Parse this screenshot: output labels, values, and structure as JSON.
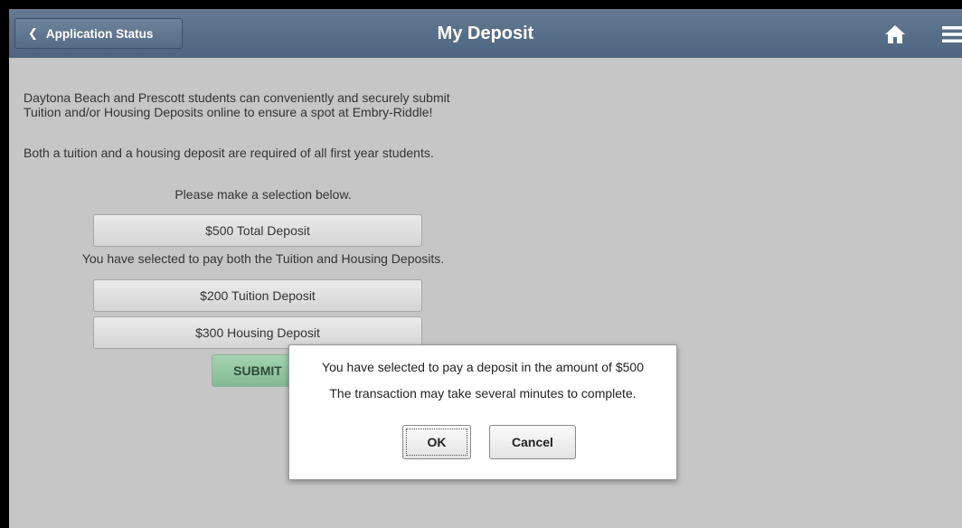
{
  "header": {
    "back_label": "Application Status",
    "title": "My Deposit",
    "home_icon": "home-icon",
    "menu_icon": "hamburger-menu-icon"
  },
  "content": {
    "intro_line1": "Daytona Beach and Prescott students can conveniently and securely submit",
    "intro_line2": "Tuition and/or Housing Deposits online to ensure a spot at Embry-Riddle!",
    "requirement": "Both a tuition and a housing deposit are required of all first year students.",
    "prompt": "Please make a selection below.",
    "total_deposit_label": "$500 Total Deposit",
    "selection_text": "You have selected to pay both the Tuition and Housing Deposits.",
    "tuition_deposit_label": "$200 Tuition Deposit",
    "housing_deposit_label": "$300 Housing Deposit",
    "submit_label": "SUBMIT"
  },
  "dialog": {
    "message1": "You have selected to pay a deposit in the amount of $500",
    "message2": "The transaction may take several minutes to complete.",
    "ok_label": "OK",
    "cancel_label": "Cancel"
  },
  "colors": {
    "header": "#566d86",
    "background": "#c6c6c6",
    "submit": "#94c6a3"
  }
}
